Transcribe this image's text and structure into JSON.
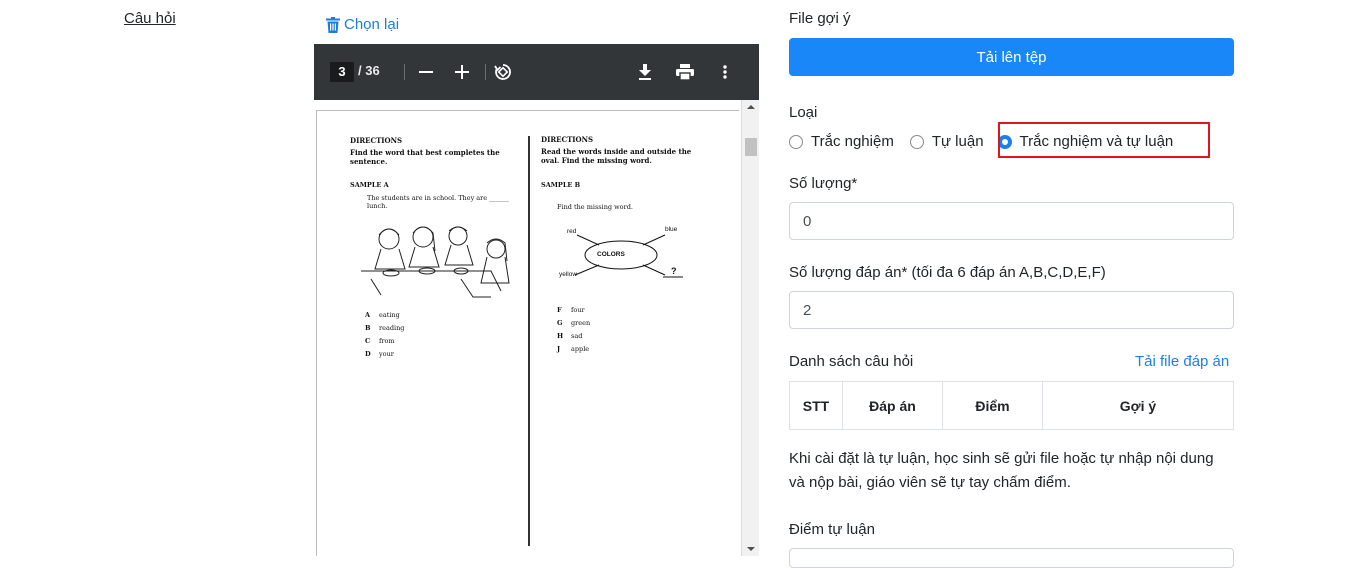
{
  "section": {
    "label": "Câu hỏi"
  },
  "viewer": {
    "choose_again": "Chọn lại",
    "page_current": "3",
    "page_total": "/ 36",
    "page": {
      "left": {
        "directions": "DIRECTIONS",
        "instruction": "Find the word that best completes the sentence.",
        "sample": "SAMPLE A",
        "question": "The students are in school. They are ______ lunch.",
        "answers": [
          {
            "letter": "A",
            "text": "eating"
          },
          {
            "letter": "B",
            "text": "reading"
          },
          {
            "letter": "C",
            "text": "from"
          },
          {
            "letter": "D",
            "text": "your"
          }
        ]
      },
      "right": {
        "directions": "DIRECTIONS",
        "instruction": "Read the words inside and outside the oval. Find the missing word.",
        "sample": "SAMPLE B",
        "question": "Find the missing word.",
        "oval_center": "COLORS",
        "oval_words": [
          "red",
          "blue",
          "yellow",
          "?"
        ],
        "answers": [
          {
            "letter": "F",
            "text": "four"
          },
          {
            "letter": "G",
            "text": "green"
          },
          {
            "letter": "H",
            "text": "sad"
          },
          {
            "letter": "J",
            "text": "apple"
          }
        ]
      }
    }
  },
  "form": {
    "file_hint_label": "File gợi ý",
    "upload_button": "Tải lên tệp",
    "type_label": "Loại",
    "type_options": [
      "Trắc nghiệm",
      "Tự luận",
      "Trắc nghiệm và tự luận"
    ],
    "type_selected": "Trắc nghiệm và tự luận",
    "quantity_label": "Số lượng*",
    "quantity_value": "0",
    "answer_count_label": "Số lượng đáp án* (tối đa 6 đáp án A,B,C,D,E,F)",
    "answer_count_value": "2",
    "question_list_label": "Danh sách câu hỏi",
    "download_answers_link": "Tải file đáp án",
    "table_headers": [
      "STT",
      "Đáp án",
      "Điểm",
      "Gợi ý"
    ],
    "essay_note": "Khi cài đặt là tự luận, học sinh sẽ gửi file hoặc tự nhập nội dung và nộp bài, giáo viên sẽ tự tay chấm điểm.",
    "essay_score_label": "Điểm tự luận"
  },
  "colors": {
    "primary": "#1a87f8",
    "highlight": "#e0141e",
    "toolbar": "#323639"
  }
}
